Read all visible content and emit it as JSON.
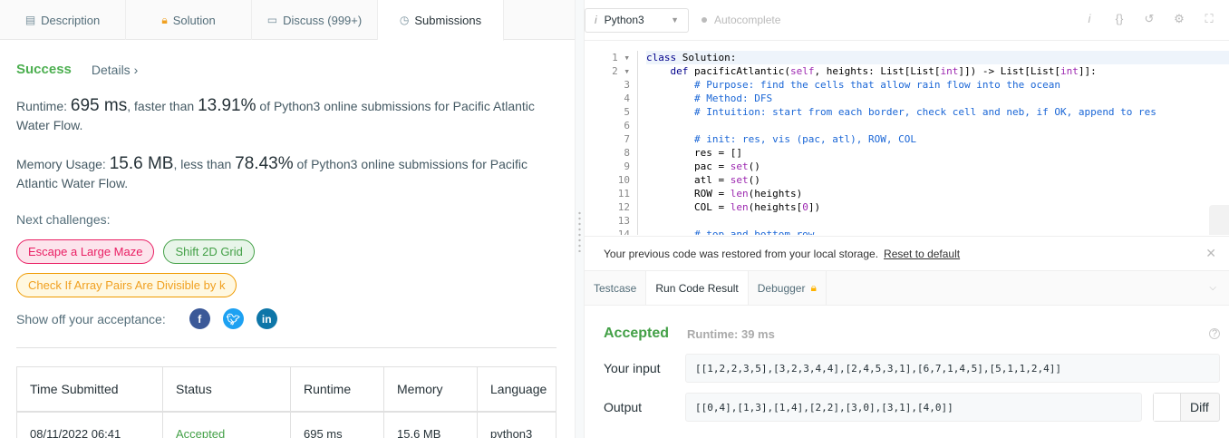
{
  "tabs": [
    {
      "label": "Description",
      "icon": "description-icon"
    },
    {
      "label": "Solution",
      "icon": "lock-icon"
    },
    {
      "label": "Discuss (999+)",
      "icon": "discuss-icon"
    },
    {
      "label": "Submissions",
      "icon": "clock-icon"
    }
  ],
  "status": {
    "label": "Success",
    "details": "Details ›"
  },
  "runtime": {
    "prefix": "Runtime: ",
    "value": "695 ms",
    "mid": ", faster than ",
    "pct": "13.91%",
    "suffix": " of Python3 online submissions for Pacific Atlantic Water Flow."
  },
  "memory": {
    "prefix": "Memory Usage: ",
    "value": "15.6 MB",
    "mid": ", less than ",
    "pct": "78.43%",
    "suffix": " of Python3 online submissions for Pacific Atlantic Water Flow."
  },
  "next": {
    "label": "Next challenges:",
    "items": [
      "Escape a Large Maze",
      "Shift 2D Grid",
      "Check If Array Pairs Are Divisible by k"
    ]
  },
  "share": {
    "label": "Show off your acceptance:"
  },
  "table": {
    "headers": [
      "Time Submitted",
      "Status",
      "Runtime",
      "Memory",
      "Language"
    ],
    "row": [
      "08/11/2022 06:41",
      "Accepted",
      "695 ms",
      "15.6 MB",
      "python3"
    ]
  },
  "editor": {
    "language": "Python3",
    "autocomplete": "Autocomplete",
    "line_numbers": [
      "1 ▾",
      "2 ▾",
      "3",
      "4",
      "5",
      "6",
      "7",
      "8",
      "9",
      "10",
      "11",
      "12",
      "13",
      "14"
    ]
  },
  "restore": {
    "text": "Your previous code was restored from your local storage.",
    "link": "Reset to default"
  },
  "result_tabs": [
    "Testcase",
    "Run Code Result",
    "Debugger"
  ],
  "result": {
    "status": "Accepted",
    "runtime": "Runtime: 39 ms",
    "input_label": "Your input",
    "input": "[[1,2,2,3,5],[3,2,3,4,4],[2,4,5,3,1],[6,7,1,4,5],[5,1,1,2,4]]",
    "output_label": "Output",
    "output": "[[0,4],[1,3],[1,4],[2,2],[3,0],[3,1],[4,0]]",
    "diff": "Diff"
  }
}
